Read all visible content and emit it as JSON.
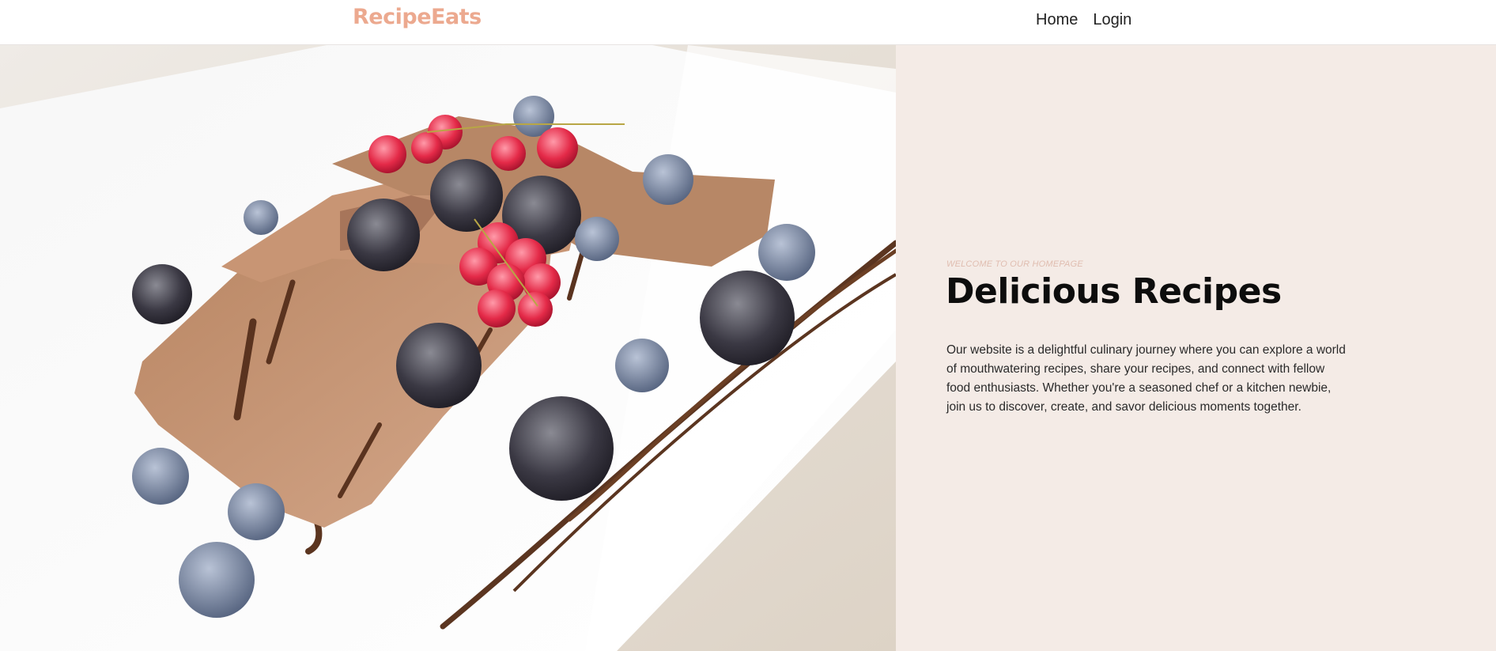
{
  "navbar": {
    "brand": "RecipeEats",
    "links": [
      {
        "label": "Home"
      },
      {
        "label": "Login"
      }
    ]
  },
  "hero": {
    "image_description_icon": "dessert-photo",
    "eyebrow": "WELCOME TO OUR HOMEPAGE",
    "title": "Delicious Recipes",
    "description": "Our website is a delightful culinary journey where you can explore a world of mouthwatering recipes, share your recipes, and connect with fellow food enthusiasts. Whether you're a seasoned chef or a kitchen newbie, join us to discover, create, and savor delicious moments together."
  },
  "colors": {
    "brand": "#eca98f",
    "panel_background": "#f4ebe6",
    "eyebrow": "#e0bdb0"
  }
}
